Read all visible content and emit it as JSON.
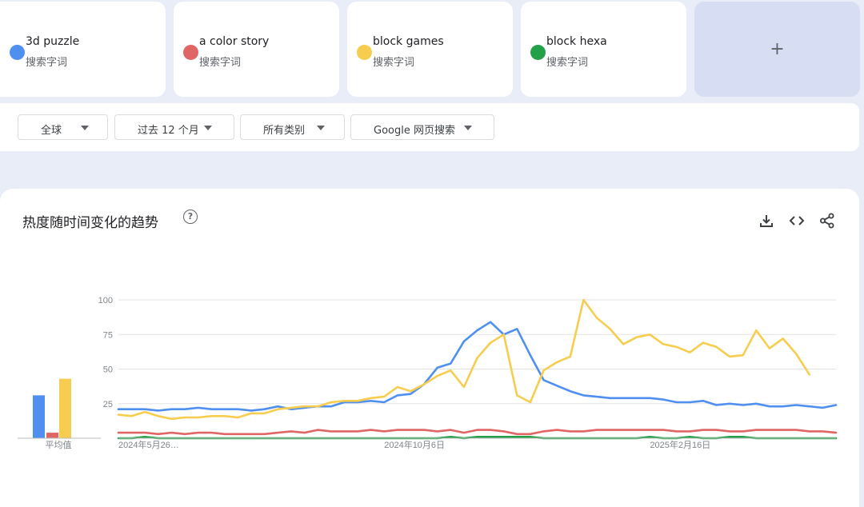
{
  "terms": [
    {
      "name": "3d puzzle",
      "sub": "搜索字词",
      "color": "#4f8ff0"
    },
    {
      "name": "a color story",
      "sub": "搜索字词",
      "color": "#e06666"
    },
    {
      "name": "block games",
      "sub": "搜索字词",
      "color": "#f6cd4e"
    },
    {
      "name": "block hexa",
      "sub": "搜索字词",
      "color": "#24a148"
    }
  ],
  "add_button": {
    "label": "+"
  },
  "filters": [
    {
      "label": "全球",
      "icon": "chevron-down-icon"
    },
    {
      "label": "过去 12 个月",
      "icon": "chevron-down-icon"
    },
    {
      "label": "所有类别",
      "icon": "chevron-down-icon"
    },
    {
      "label": "Google 网页搜索",
      "icon": "chevron-down-icon"
    }
  ],
  "panel": {
    "title": "热度随时间变化的趋势",
    "help_label": "?",
    "actions": [
      "download-icon",
      "embed-code-icon",
      "share-icon"
    ]
  },
  "chart_data": {
    "type": "line",
    "yticks": [
      25,
      50,
      75,
      100
    ],
    "ylim": [
      0,
      100
    ],
    "x_ticks": [
      "2024年5月26…",
      "2024年10月6日",
      "2025年2月16日"
    ],
    "x_tick_indices": [
      0,
      20,
      40
    ],
    "grid": true,
    "average_label": "平均值",
    "averages": [
      {
        "name": "3d puzzle",
        "value": 31
      },
      {
        "name": "a color story",
        "value": 4
      },
      {
        "name": "block games",
        "value": 43
      },
      {
        "name": "block hexa",
        "value": 0
      }
    ],
    "series": [
      {
        "name": "3d puzzle",
        "color": "#4f8ff0",
        "values": [
          21,
          21,
          21,
          20,
          21,
          21,
          22,
          21,
          21,
          21,
          20,
          21,
          23,
          21,
          22,
          23,
          23,
          26,
          26,
          27,
          26,
          31,
          32,
          39,
          51,
          54,
          70,
          78,
          84,
          75,
          79,
          60,
          42,
          38,
          34,
          31,
          30,
          29,
          29,
          29,
          29,
          28,
          26,
          26,
          27,
          24,
          25,
          24,
          25,
          23,
          23,
          24,
          23,
          22,
          24
        ]
      },
      {
        "name": "a color story",
        "color": "#e06666",
        "values": [
          4,
          4,
          4,
          3,
          4,
          3,
          4,
          4,
          3,
          3,
          3,
          3,
          4,
          5,
          4,
          6,
          5,
          5,
          5,
          6,
          5,
          6,
          6,
          6,
          5,
          6,
          4,
          6,
          6,
          5,
          3,
          3,
          5,
          6,
          5,
          5,
          6,
          6,
          6,
          6,
          6,
          6,
          5,
          5,
          6,
          6,
          5,
          5,
          6,
          6,
          6,
          6,
          5,
          5,
          4
        ]
      },
      {
        "name": "block games",
        "color": "#f6cd4e",
        "values": [
          17,
          16,
          19,
          16,
          14,
          15,
          15,
          16,
          16,
          15,
          18,
          18,
          21,
          22,
          23,
          23,
          26,
          27,
          27,
          29,
          30,
          37,
          34,
          39,
          45,
          49,
          37,
          58,
          69,
          75,
          31,
          26,
          49,
          55,
          59,
          100,
          87,
          79,
          68,
          73,
          75,
          68,
          66,
          62,
          69,
          66,
          59,
          60,
          78,
          65,
          72,
          61,
          46
        ]
      },
      {
        "name": "block hexa",
        "color": "#24a148",
        "values": [
          0,
          0,
          1,
          0,
          0,
          0,
          0,
          0,
          0,
          0,
          0,
          0,
          0,
          0,
          0,
          0,
          0,
          0,
          0,
          0,
          0,
          0,
          0,
          0,
          0,
          1,
          0,
          1,
          1,
          1,
          1,
          1,
          0,
          0,
          0,
          0,
          0,
          0,
          0,
          0,
          1,
          0,
          0,
          1,
          0,
          0,
          1,
          1,
          0,
          0,
          0,
          0,
          0,
          0,
          0
        ]
      }
    ]
  }
}
